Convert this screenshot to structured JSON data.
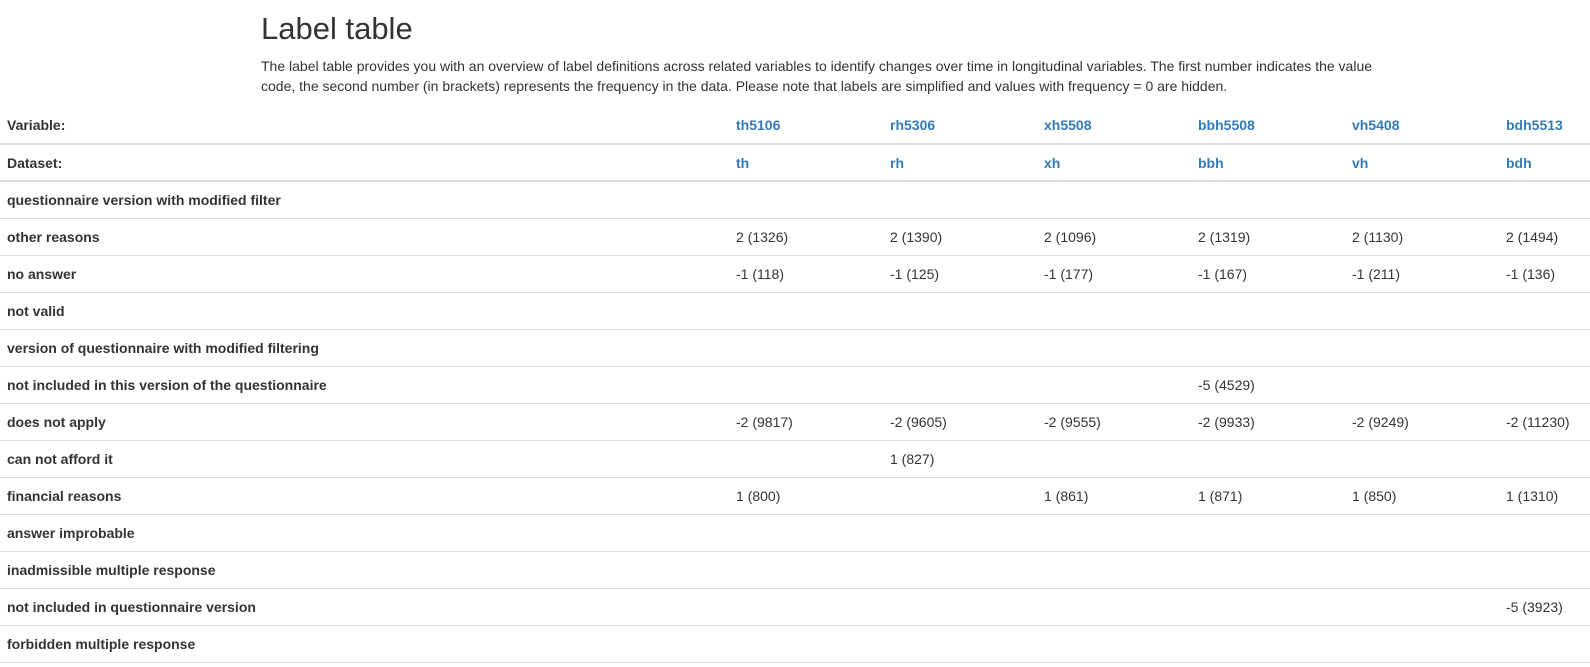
{
  "page": {
    "title": "Label table",
    "description": "The label table provides you with an overview of label definitions across related variables to identify changes over time in longitudinal variables. The first number indicates the value code, the second number (in brackets) represents the frequency in the data. Please note that labels are simplified and values with frequency = 0 are hidden."
  },
  "table": {
    "variable_label": "Variable:",
    "dataset_label": "Dataset:",
    "variables": [
      "th5106",
      "rh5306",
      "xh5508",
      "bbh5508",
      "vh5408",
      "bdh5513"
    ],
    "datasets": [
      "th",
      "rh",
      "xh",
      "bbh",
      "vh",
      "bdh"
    ],
    "rows": [
      {
        "label": "questionnaire version with modified filter",
        "values": [
          "",
          "",
          "",
          "",
          "",
          ""
        ]
      },
      {
        "label": "other reasons",
        "values": [
          "2 (1326)",
          "2 (1390)",
          "2 (1096)",
          "2 (1319)",
          "2 (1130)",
          "2 (1494)"
        ]
      },
      {
        "label": "no answer",
        "values": [
          "-1 (118)",
          "-1 (125)",
          "-1 (177)",
          "-1 (167)",
          "-1 (211)",
          "-1 (136)"
        ]
      },
      {
        "label": "not valid",
        "values": [
          "",
          "",
          "",
          "",
          "",
          ""
        ]
      },
      {
        "label": "version of questionnaire with modified filtering",
        "values": [
          "",
          "",
          "",
          "",
          "",
          ""
        ]
      },
      {
        "label": "not included in this version of the questionnaire",
        "values": [
          "",
          "",
          "",
          "-5 (4529)",
          "",
          ""
        ]
      },
      {
        "label": "does not apply",
        "values": [
          "-2 (9817)",
          "-2 (9605)",
          "-2 (9555)",
          "-2 (9933)",
          "-2 (9249)",
          "-2 (11230)"
        ]
      },
      {
        "label": "can not afford it",
        "values": [
          "",
          "1 (827)",
          "",
          "",
          "",
          ""
        ]
      },
      {
        "label": "financial reasons",
        "values": [
          "1 (800)",
          "",
          "1 (861)",
          "1 (871)",
          "1 (850)",
          "1 (1310)"
        ]
      },
      {
        "label": "answer improbable",
        "values": [
          "",
          "",
          "",
          "",
          "",
          ""
        ]
      },
      {
        "label": "inadmissible multiple response",
        "values": [
          "",
          "",
          "",
          "",
          "",
          ""
        ]
      },
      {
        "label": "not included in questionnaire version",
        "values": [
          "",
          "",
          "",
          "",
          "",
          "-5 (3923)"
        ]
      },
      {
        "label": "forbidden multiple response",
        "values": [
          "",
          "",
          "",
          "",
          "",
          ""
        ]
      }
    ]
  },
  "colors": {
    "link": "#337ab7",
    "text": "#333333",
    "border": "#dddddd"
  }
}
